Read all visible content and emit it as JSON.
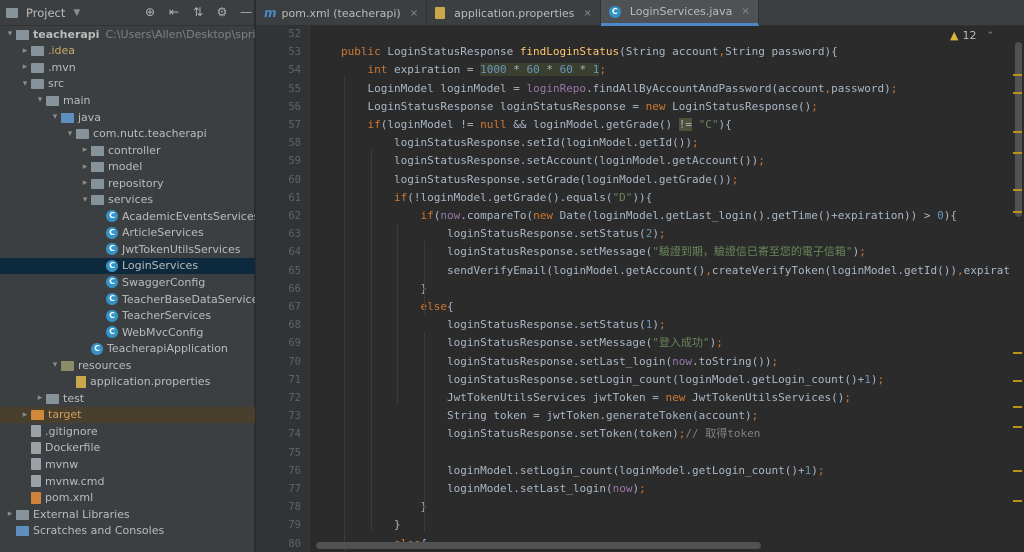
{
  "project_panel": {
    "title": "Project",
    "tools": [
      "target-icon",
      "collapse-all-icon",
      "expand-all-icon",
      "gear-icon",
      "minimize-icon"
    ],
    "tree": [
      {
        "depth": 0,
        "arrow": "▾",
        "icon": "folder",
        "label": "teacherapi",
        "bold": true,
        "path": "C:\\Users\\Allen\\Desktop\\spring boo"
      },
      {
        "depth": 1,
        "arrow": "▸",
        "icon": "folder",
        "label": ".idea",
        "style": "dim"
      },
      {
        "depth": 1,
        "arrow": "▸",
        "icon": "folder",
        "label": ".mvn"
      },
      {
        "depth": 1,
        "arrow": "▾",
        "icon": "folder",
        "label": "src"
      },
      {
        "depth": 2,
        "arrow": "▾",
        "icon": "folder",
        "label": "main"
      },
      {
        "depth": 3,
        "arrow": "▾",
        "icon": "folder-blue",
        "label": "java"
      },
      {
        "depth": 4,
        "arrow": "▾",
        "icon": "folder",
        "label": "com.nutc.teacherapi"
      },
      {
        "depth": 5,
        "arrow": "▸",
        "icon": "folder",
        "label": "controller"
      },
      {
        "depth": 5,
        "arrow": "▸",
        "icon": "folder",
        "label": "model"
      },
      {
        "depth": 5,
        "arrow": "▸",
        "icon": "folder",
        "label": "repository"
      },
      {
        "depth": 5,
        "arrow": "▾",
        "icon": "folder",
        "label": "services"
      },
      {
        "depth": 6,
        "arrow": "",
        "icon": "class",
        "label": "AcademicEventsServices"
      },
      {
        "depth": 6,
        "arrow": "",
        "icon": "class",
        "label": "ArticleServices"
      },
      {
        "depth": 6,
        "arrow": "",
        "icon": "class",
        "label": "JwtTokenUtilsServices"
      },
      {
        "depth": 6,
        "arrow": "",
        "icon": "class",
        "label": "LoginServices",
        "selected": true
      },
      {
        "depth": 6,
        "arrow": "",
        "icon": "class",
        "label": "SwaggerConfig"
      },
      {
        "depth": 6,
        "arrow": "",
        "icon": "class",
        "label": "TeacherBaseDataServices"
      },
      {
        "depth": 6,
        "arrow": "",
        "icon": "class",
        "label": "TeacherServices"
      },
      {
        "depth": 6,
        "arrow": "",
        "icon": "class",
        "label": "WebMvcConfig"
      },
      {
        "depth": 5,
        "arrow": "",
        "icon": "class",
        "label": "TeacherapiApplication"
      },
      {
        "depth": 3,
        "arrow": "▾",
        "icon": "folder-res",
        "label": "resources"
      },
      {
        "depth": 4,
        "arrow": "",
        "icon": "props",
        "label": "application.properties"
      },
      {
        "depth": 2,
        "arrow": "▸",
        "icon": "folder",
        "label": "test"
      },
      {
        "depth": 1,
        "arrow": "▸",
        "icon": "folder-orange",
        "label": "target",
        "style": "orange",
        "highlight": true
      },
      {
        "depth": 1,
        "arrow": "",
        "icon": "file",
        "label": ".gitignore"
      },
      {
        "depth": 1,
        "arrow": "",
        "icon": "file",
        "label": "Dockerfile"
      },
      {
        "depth": 1,
        "arrow": "",
        "icon": "file",
        "label": "mvnw"
      },
      {
        "depth": 1,
        "arrow": "",
        "icon": "file",
        "label": "mvnw.cmd"
      },
      {
        "depth": 1,
        "arrow": "",
        "icon": "xml",
        "label": "pom.xml"
      },
      {
        "depth": 0,
        "arrow": "▸",
        "icon": "lib",
        "label": "External Libraries"
      },
      {
        "depth": 0,
        "arrow": "",
        "icon": "scratch",
        "label": "Scratches and Consoles"
      }
    ]
  },
  "tabs": [
    {
      "label": "pom.xml (teacherapi)",
      "icon": "m",
      "active": false
    },
    {
      "label": "application.properties",
      "icon": "props",
      "active": false
    },
    {
      "label": "LoginServices.java",
      "icon": "class",
      "active": true
    }
  ],
  "inspection": {
    "warnings": "12"
  },
  "editor": {
    "lines": [
      {
        "n": "52",
        "indent": 0,
        "html": ""
      },
      {
        "n": "53",
        "indent": 1,
        "html": "<span class=\"kw\">public </span>LoginStatusResponse <span class=\"fn\">findLoginStatus</span>(String account<span class=\"kw\">,</span>String password){"
      },
      {
        "n": "54",
        "indent": 2,
        "html": "<span class=\"kw\">int </span>expiration = <span class=\"hlbox\"><span class=\"num\">1000 </span>* <span class=\"num\">60 </span>* <span class=\"num\">60 </span>* <span class=\"num\">1</span></span><span class=\"kw\">;</span>"
      },
      {
        "n": "55",
        "indent": 2,
        "html": "LoginModel loginModel = <span class=\"fld\">loginRepo</span>.findAllByAccountAndPassword(account<span class=\"kw\">,</span>password)<span class=\"kw\">;</span>"
      },
      {
        "n": "56",
        "indent": 2,
        "html": "LoginStatusResponse loginStatusResponse = <span class=\"kw\">new </span>LoginStatusResponse()<span class=\"kw\">;</span>"
      },
      {
        "n": "57",
        "indent": 2,
        "html": "<span class=\"kw\">if</span>(loginModel != <span class=\"kw\">null </span>&amp;&amp; loginModel.getGrade() <span class=\"warnbox\">!=</span> <span class=\"str\">\"C\"</span>){"
      },
      {
        "n": "58",
        "indent": 3,
        "html": "loginStatusResponse.setId(loginModel.getId())<span class=\"kw\">;</span>"
      },
      {
        "n": "59",
        "indent": 3,
        "html": "loginStatusResponse.setAccount(loginModel.getAccount())<span class=\"kw\">;</span>"
      },
      {
        "n": "60",
        "indent": 3,
        "html": "loginStatusResponse.setGrade(loginModel.getGrade())<span class=\"kw\">;</span>"
      },
      {
        "n": "61",
        "indent": 3,
        "html": "<span class=\"kw\">if</span>(!loginModel.getGrade().equals(<span class=\"str\">\"D\"</span>)){"
      },
      {
        "n": "62",
        "indent": 4,
        "html": "<span class=\"kw\">if</span>(<span class=\"fld\">now</span>.compareTo(<span class=\"kw\">new </span>Date(loginModel.getLast_login().getTime()+expiration)) &gt; <span class=\"num\">0</span>){"
      },
      {
        "n": "63",
        "indent": 5,
        "html": "loginStatusResponse.setStatus(<span class=\"num\">2</span>)<span class=\"kw\">;</span>"
      },
      {
        "n": "64",
        "indent": 5,
        "html": "loginStatusResponse.setMessage(<span class=\"str\">\"驗證到期，驗證信已寄至您的電子信箱\"</span>)<span class=\"kw\">;</span>"
      },
      {
        "n": "65",
        "indent": 5,
        "html": "sendVerifyEmail(loginModel.getAccount()<span class=\"kw\">,</span>createVerifyToken(loginModel.getId())<span class=\"kw\">,</span>expiratio"
      },
      {
        "n": "66",
        "indent": 4,
        "html": "}"
      },
      {
        "n": "67",
        "indent": 4,
        "html": "<span class=\"kw\">else</span>{"
      },
      {
        "n": "68",
        "indent": 5,
        "html": "loginStatusResponse.setStatus(<span class=\"num\">1</span>)<span class=\"kw\">;</span>"
      },
      {
        "n": "69",
        "indent": 5,
        "html": "loginStatusResponse.setMessage(<span class=\"str\">\"登入成功\"</span>)<span class=\"kw\">;</span>"
      },
      {
        "n": "70",
        "indent": 5,
        "html": "loginStatusResponse.setLast_login(<span class=\"fld\">now</span>.toString())<span class=\"kw\">;</span>"
      },
      {
        "n": "71",
        "indent": 5,
        "html": "loginStatusResponse.setLogin_count(loginModel.getLogin_count()+<span class=\"num\">1</span>)<span class=\"kw\">;</span>"
      },
      {
        "n": "72",
        "indent": 5,
        "html": "JwtTokenUtilsServices jwtToken = <span class=\"kw\">new </span>JwtTokenUtilsServices()<span class=\"kw\">;</span>"
      },
      {
        "n": "73",
        "indent": 5,
        "html": "String token = jwtToken.generateToken(account)<span class=\"kw\">;</span>"
      },
      {
        "n": "74",
        "indent": 5,
        "html": "loginStatusResponse.setToken(token)<span class=\"kw\">;</span><span class=\"cmt\">// 取得token</span>"
      },
      {
        "n": "75",
        "indent": 0,
        "html": ""
      },
      {
        "n": "76",
        "indent": 5,
        "html": "loginModel.setLogin_count(loginModel.getLogin_count()+<span class=\"num\">1</span>)<span class=\"kw\">;</span>"
      },
      {
        "n": "77",
        "indent": 5,
        "html": "loginModel.setLast_login(<span class=\"fld\">now</span>)<span class=\"kw\">;</span>"
      },
      {
        "n": "78",
        "indent": 4,
        "html": "}"
      },
      {
        "n": "79",
        "indent": 3,
        "html": "}"
      },
      {
        "n": "80",
        "indent": 3,
        "html": "<span class=\"kw\">else</span>{"
      }
    ]
  }
}
